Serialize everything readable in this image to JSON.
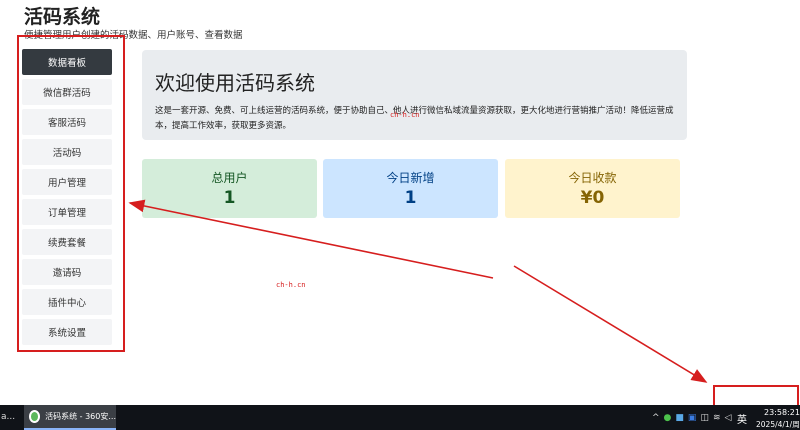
{
  "header": {
    "title": "活码系统",
    "subtitle": "便捷管理用户创建的活码数据、用户账号、查看数据"
  },
  "sidebar": {
    "items": [
      {
        "label": "数据看板",
        "active": true
      },
      {
        "label": "微信群活码",
        "active": false
      },
      {
        "label": "客服活码",
        "active": false
      },
      {
        "label": "活动码",
        "active": false
      },
      {
        "label": "用户管理",
        "active": false
      },
      {
        "label": "订单管理",
        "active": false
      },
      {
        "label": "续费套餐",
        "active": false
      },
      {
        "label": "邀请码",
        "active": false
      },
      {
        "label": "插件中心",
        "active": false
      },
      {
        "label": "系统设置",
        "active": false
      }
    ]
  },
  "hero": {
    "title": "欢迎使用活码系统",
    "text": "这是一套开源、免费、可上线运营的活码系统，便于协助自己、他人进行微信私域流量资源获取，更大化地进行营销推广活动！降低运营成本，提高工作效率，获取更多资源。"
  },
  "stats": [
    {
      "label": "总用户",
      "value": "1"
    },
    {
      "label": "今日新增",
      "value": "1"
    },
    {
      "label": "今日收款",
      "value": "¥0"
    }
  ],
  "watermarks": [
    "ch-h.cn",
    "ch-h.cn"
  ],
  "taskbar": {
    "left_stub": "a...",
    "app_label": "活码系统 - 360安...",
    "ime": "英",
    "time": "23:58:21",
    "date": "2025/4/1/周"
  },
  "annotation_color": "#d61e1e"
}
